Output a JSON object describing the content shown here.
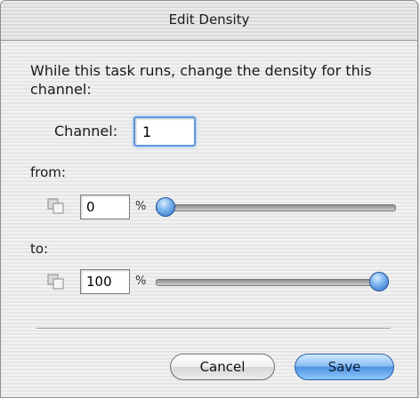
{
  "window": {
    "title": "Edit Density"
  },
  "instruction": "While this task runs, change the density for this channel:",
  "channel": {
    "label": "Channel:",
    "value": "1"
  },
  "from": {
    "label": "from:",
    "value": "0",
    "unit": "%",
    "slider_percent": 0
  },
  "to": {
    "label": "to:",
    "value": "100",
    "unit": "%",
    "slider_percent": 100
  },
  "buttons": {
    "cancel_label": "Cancel",
    "save_label": "Save"
  },
  "icons": {
    "lock": "lock-toggle-icon"
  },
  "colors": {
    "accent": "#4f94e2",
    "focus_ring": "#5e99e0"
  }
}
